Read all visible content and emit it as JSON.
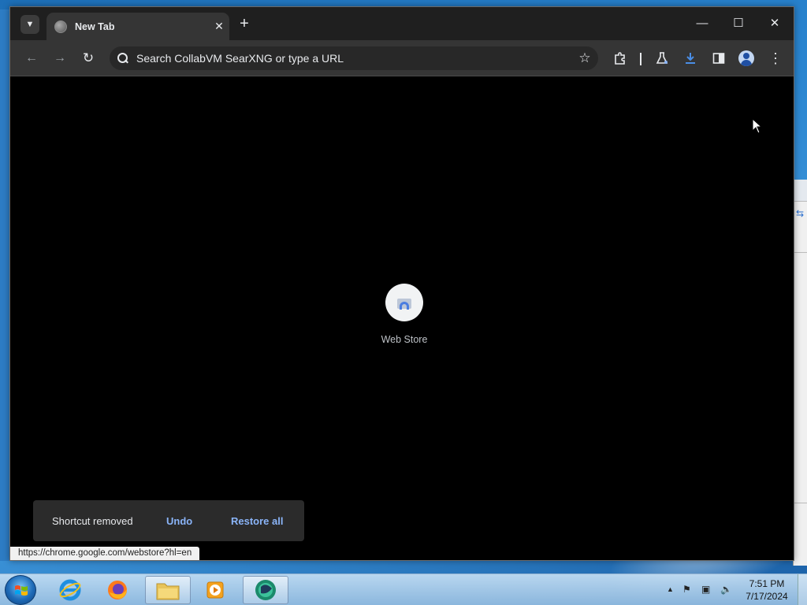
{
  "browser": {
    "tab": {
      "title": "New Tab",
      "close": "✕"
    },
    "new_tab": "+",
    "window_controls": {
      "minimize": "—",
      "maximize": "☐",
      "close": "✕"
    },
    "omnibox": {
      "placeholder": "Search CollabVM SearXNG or type a URL"
    }
  },
  "shortcut_tile": {
    "label": "Web Store"
  },
  "toast": {
    "message": "Shortcut removed",
    "undo": "Undo",
    "restore_all": "Restore all"
  },
  "status_url": "https://chrome.google.com/webstore?hl=en",
  "taskbar": {
    "apps": [
      "start",
      "internet-explorer",
      "firefox",
      "file-explorer",
      "media-player",
      "chrome"
    ],
    "clock": {
      "time": "7:51 PM",
      "date": "7/17/2024"
    }
  }
}
